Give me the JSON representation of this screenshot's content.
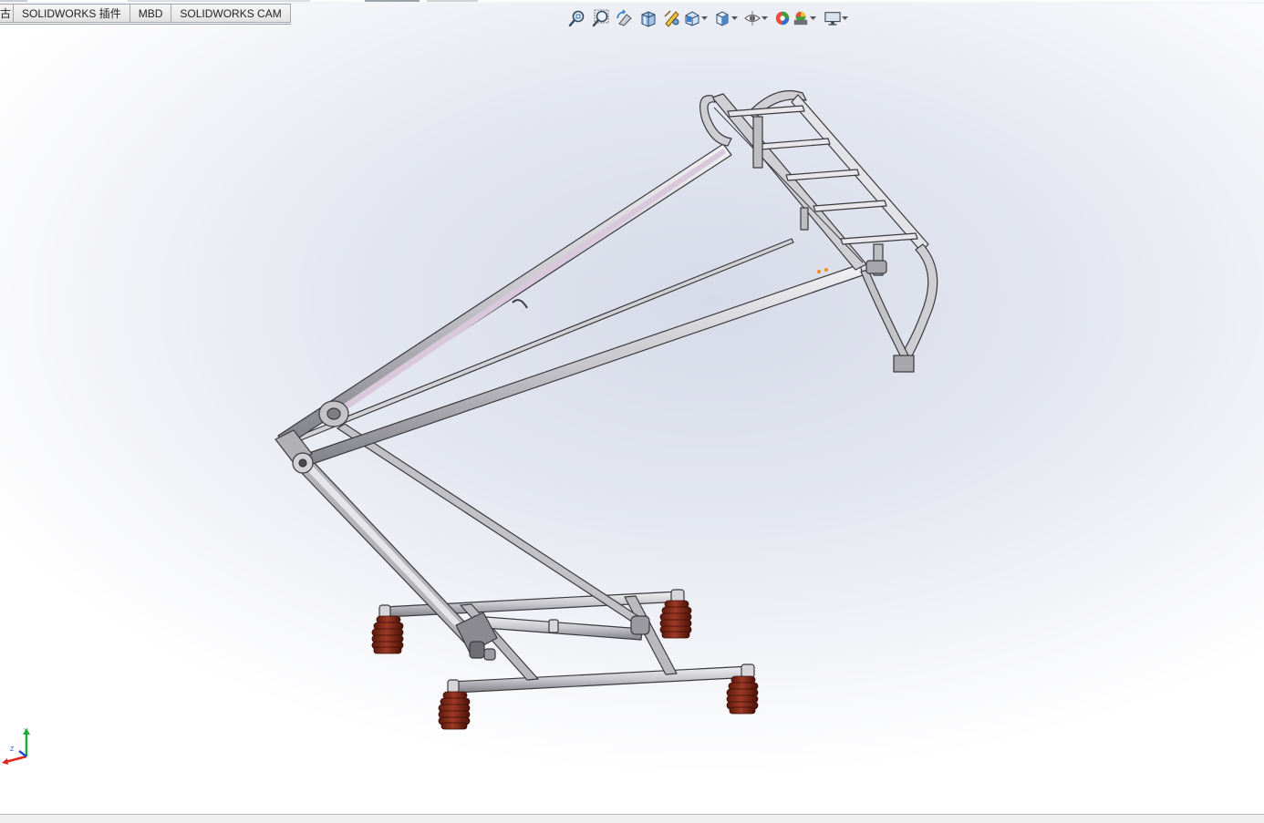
{
  "command_manager": {
    "tabs": [
      {
        "label": "古"
      },
      {
        "label": "SOLIDWORKS 插件"
      },
      {
        "label": "MBD"
      },
      {
        "label": "SOLIDWORKS CAM"
      }
    ]
  },
  "heads_up_toolbar": {
    "icons": [
      "zoom-to-fit-icon",
      "zoom-to-area-icon",
      "previous-view-icon",
      "section-view-icon",
      "dynamic-annotation-views-icon",
      "view-orientation-icon",
      "display-style-icon",
      "hide-show-items-icon",
      "edit-appearance-icon",
      "apply-scene-icon",
      "view-settings-icon"
    ]
  },
  "triad": {
    "x": "X",
    "y": "Y",
    "z": "Z"
  },
  "colors": {
    "frame": "#c4c4c8",
    "frame_edge": "#3a3a3e",
    "insulator": "#8b2e1e",
    "insulator_dark": "#4e130a",
    "axis_x": "#e0251b",
    "axis_y": "#1fa83a",
    "axis_z": "#1f4fd8"
  }
}
